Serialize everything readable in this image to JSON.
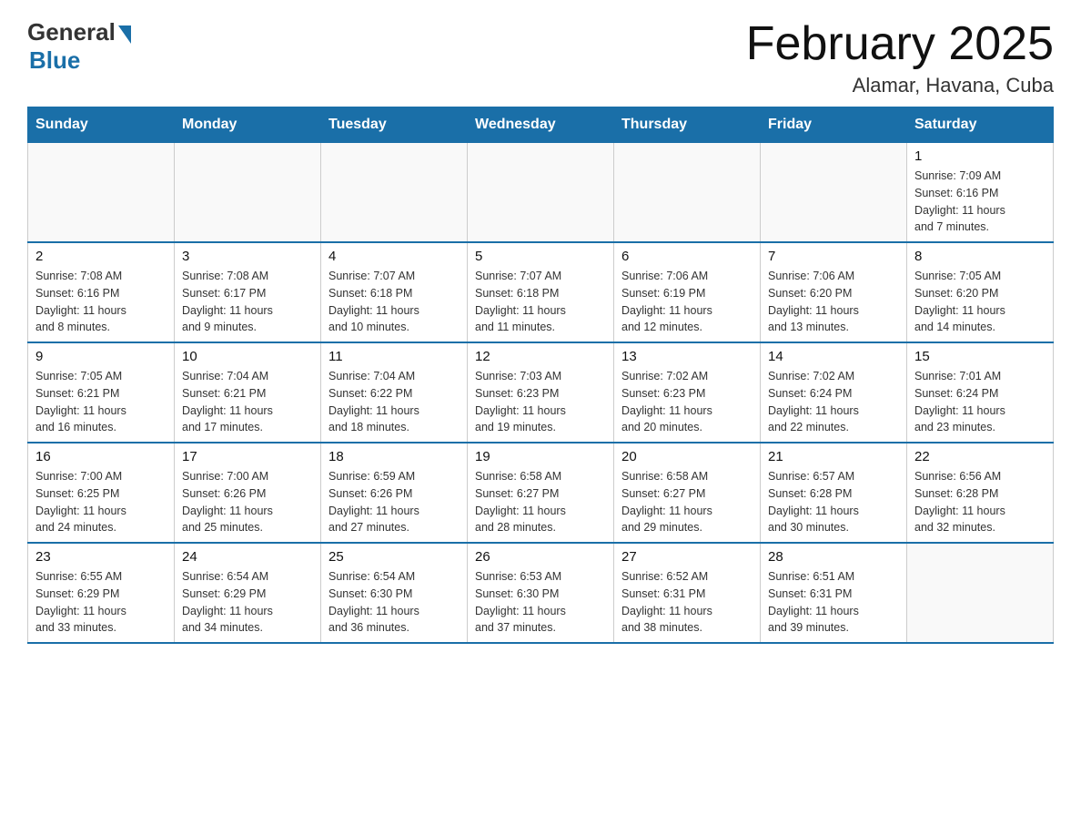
{
  "header": {
    "logo_general": "General",
    "logo_blue": "Blue",
    "month_title": "February 2025",
    "location": "Alamar, Havana, Cuba"
  },
  "days_of_week": [
    "Sunday",
    "Monday",
    "Tuesday",
    "Wednesday",
    "Thursday",
    "Friday",
    "Saturday"
  ],
  "weeks": [
    [
      {
        "day": "",
        "info": ""
      },
      {
        "day": "",
        "info": ""
      },
      {
        "day": "",
        "info": ""
      },
      {
        "day": "",
        "info": ""
      },
      {
        "day": "",
        "info": ""
      },
      {
        "day": "",
        "info": ""
      },
      {
        "day": "1",
        "info": "Sunrise: 7:09 AM\nSunset: 6:16 PM\nDaylight: 11 hours\nand 7 minutes."
      }
    ],
    [
      {
        "day": "2",
        "info": "Sunrise: 7:08 AM\nSunset: 6:16 PM\nDaylight: 11 hours\nand 8 minutes."
      },
      {
        "day": "3",
        "info": "Sunrise: 7:08 AM\nSunset: 6:17 PM\nDaylight: 11 hours\nand 9 minutes."
      },
      {
        "day": "4",
        "info": "Sunrise: 7:07 AM\nSunset: 6:18 PM\nDaylight: 11 hours\nand 10 minutes."
      },
      {
        "day": "5",
        "info": "Sunrise: 7:07 AM\nSunset: 6:18 PM\nDaylight: 11 hours\nand 11 minutes."
      },
      {
        "day": "6",
        "info": "Sunrise: 7:06 AM\nSunset: 6:19 PM\nDaylight: 11 hours\nand 12 minutes."
      },
      {
        "day": "7",
        "info": "Sunrise: 7:06 AM\nSunset: 6:20 PM\nDaylight: 11 hours\nand 13 minutes."
      },
      {
        "day": "8",
        "info": "Sunrise: 7:05 AM\nSunset: 6:20 PM\nDaylight: 11 hours\nand 14 minutes."
      }
    ],
    [
      {
        "day": "9",
        "info": "Sunrise: 7:05 AM\nSunset: 6:21 PM\nDaylight: 11 hours\nand 16 minutes."
      },
      {
        "day": "10",
        "info": "Sunrise: 7:04 AM\nSunset: 6:21 PM\nDaylight: 11 hours\nand 17 minutes."
      },
      {
        "day": "11",
        "info": "Sunrise: 7:04 AM\nSunset: 6:22 PM\nDaylight: 11 hours\nand 18 minutes."
      },
      {
        "day": "12",
        "info": "Sunrise: 7:03 AM\nSunset: 6:23 PM\nDaylight: 11 hours\nand 19 minutes."
      },
      {
        "day": "13",
        "info": "Sunrise: 7:02 AM\nSunset: 6:23 PM\nDaylight: 11 hours\nand 20 minutes."
      },
      {
        "day": "14",
        "info": "Sunrise: 7:02 AM\nSunset: 6:24 PM\nDaylight: 11 hours\nand 22 minutes."
      },
      {
        "day": "15",
        "info": "Sunrise: 7:01 AM\nSunset: 6:24 PM\nDaylight: 11 hours\nand 23 minutes."
      }
    ],
    [
      {
        "day": "16",
        "info": "Sunrise: 7:00 AM\nSunset: 6:25 PM\nDaylight: 11 hours\nand 24 minutes."
      },
      {
        "day": "17",
        "info": "Sunrise: 7:00 AM\nSunset: 6:26 PM\nDaylight: 11 hours\nand 25 minutes."
      },
      {
        "day": "18",
        "info": "Sunrise: 6:59 AM\nSunset: 6:26 PM\nDaylight: 11 hours\nand 27 minutes."
      },
      {
        "day": "19",
        "info": "Sunrise: 6:58 AM\nSunset: 6:27 PM\nDaylight: 11 hours\nand 28 minutes."
      },
      {
        "day": "20",
        "info": "Sunrise: 6:58 AM\nSunset: 6:27 PM\nDaylight: 11 hours\nand 29 minutes."
      },
      {
        "day": "21",
        "info": "Sunrise: 6:57 AM\nSunset: 6:28 PM\nDaylight: 11 hours\nand 30 minutes."
      },
      {
        "day": "22",
        "info": "Sunrise: 6:56 AM\nSunset: 6:28 PM\nDaylight: 11 hours\nand 32 minutes."
      }
    ],
    [
      {
        "day": "23",
        "info": "Sunrise: 6:55 AM\nSunset: 6:29 PM\nDaylight: 11 hours\nand 33 minutes."
      },
      {
        "day": "24",
        "info": "Sunrise: 6:54 AM\nSunset: 6:29 PM\nDaylight: 11 hours\nand 34 minutes."
      },
      {
        "day": "25",
        "info": "Sunrise: 6:54 AM\nSunset: 6:30 PM\nDaylight: 11 hours\nand 36 minutes."
      },
      {
        "day": "26",
        "info": "Sunrise: 6:53 AM\nSunset: 6:30 PM\nDaylight: 11 hours\nand 37 minutes."
      },
      {
        "day": "27",
        "info": "Sunrise: 6:52 AM\nSunset: 6:31 PM\nDaylight: 11 hours\nand 38 minutes."
      },
      {
        "day": "28",
        "info": "Sunrise: 6:51 AM\nSunset: 6:31 PM\nDaylight: 11 hours\nand 39 minutes."
      },
      {
        "day": "",
        "info": ""
      }
    ]
  ]
}
